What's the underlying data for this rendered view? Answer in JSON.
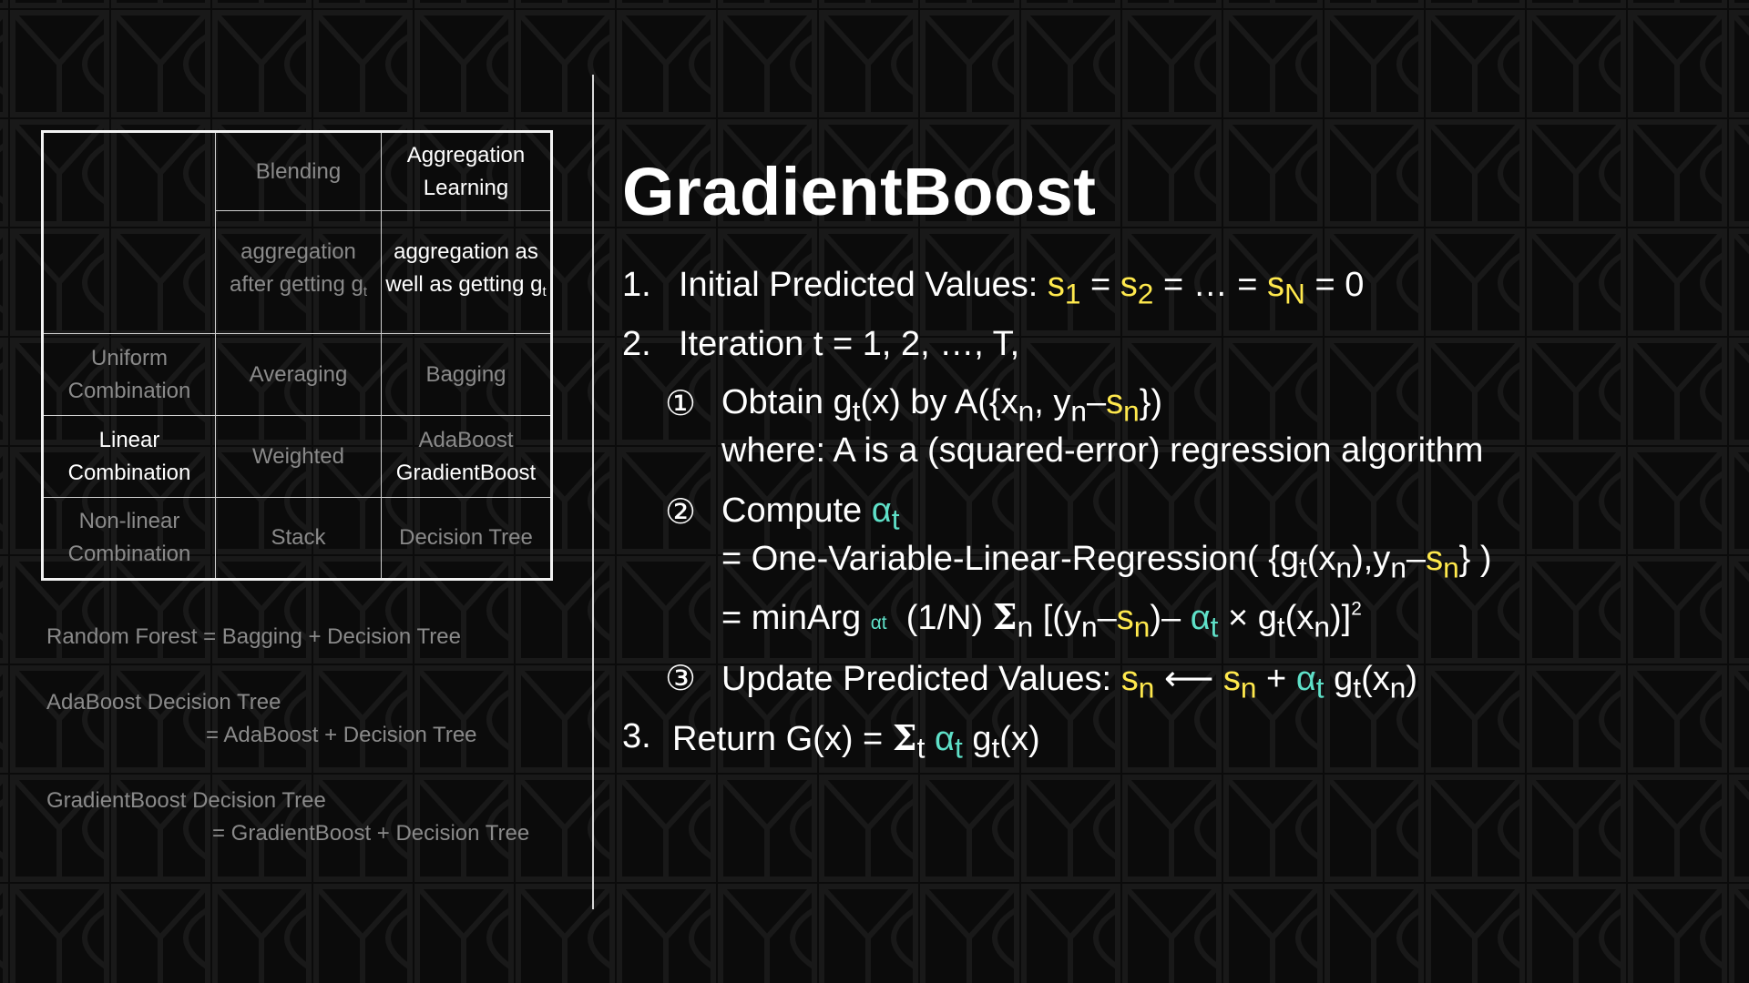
{
  "table": {
    "col_headers": [
      "Blending",
      "Aggregation Learning"
    ],
    "col_sub": [
      "aggregation after getting g",
      "aggregation as well as getting g"
    ],
    "col_sub_subscript": "t",
    "rows": [
      {
        "label": "Uniform Combination",
        "cells": [
          "Averaging",
          "Bagging"
        ]
      },
      {
        "label": "Linear Combination",
        "cells": [
          "Weighted",
          "AdaBoost",
          "GradientBoost"
        ]
      },
      {
        "label": "Non-linear Combination",
        "cells": [
          "Stack",
          "Decision Tree"
        ]
      }
    ]
  },
  "notes": {
    "rf": "Random Forest = Bagging + Decision Tree",
    "ada_l1": "AdaBoost Decision Tree",
    "ada_l2": "= AdaBoost + Decision Tree",
    "gb_l1": "GradientBoost Decision Tree",
    "gb_l2": "= GradientBoost + Decision Tree"
  },
  "slide": {
    "title": "GradientBoost",
    "step1_num": "1.",
    "step1_text": "Initial Predicted Values:",
    "step2_num": "2.",
    "step2_text": "Iteration t = 1, 2, …, T,",
    "sub1_marker": "①",
    "sub1_text": "Obtain g",
    "sub1_where": "where: A is a (squared-error) regression algorithm",
    "sub2_marker": "②",
    "sub2_text": "Compute",
    "sub2_line2": "= One-Variable-Linear-Regression(",
    "sub2_line3": "= minArg",
    "sub3_marker": "③",
    "sub3_text": "Update Predicted Values:",
    "step3_num": "3.",
    "step3_text": "Return G(x) ="
  },
  "colors": {
    "accent_yellow": "#ffe94d",
    "accent_teal": "#5fe0c8",
    "background": "#0b0b0b"
  }
}
